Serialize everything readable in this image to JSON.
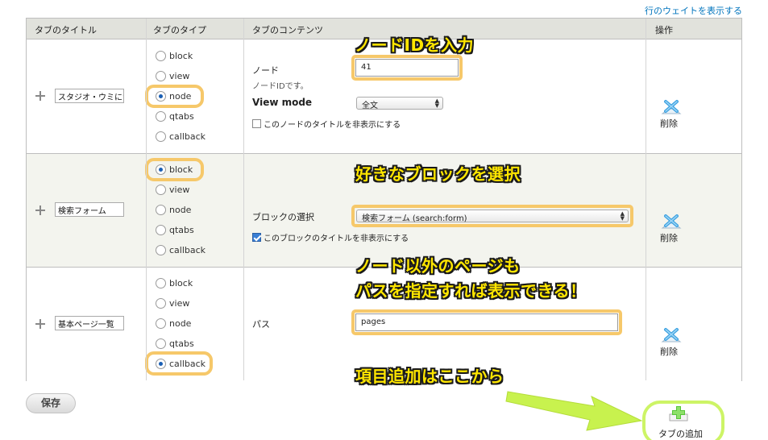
{
  "top_link": "行のウェイトを表示する",
  "table": {
    "headers": {
      "title": "タブのタイトル",
      "type": "タブのタイプ",
      "content": "タブのコンテンツ",
      "ops": "操作"
    }
  },
  "rows": [
    {
      "title_value": "スタジオ・ウミにつ",
      "radios": [
        "block",
        "view",
        "node",
        "qtabs",
        "callback"
      ],
      "selected": "node",
      "node_label": "ノード",
      "node_value": "41",
      "node_desc": "ノードIDです。",
      "view_mode_label": "View mode",
      "view_mode_value": "全文",
      "hide_title_label": "このノードのタイトルを非表示にする",
      "hide_title_checked": false,
      "delete_label": "削除"
    },
    {
      "title_value": "検索フォーム",
      "radios": [
        "block",
        "view",
        "node",
        "qtabs",
        "callback"
      ],
      "selected": "block",
      "block_label": "ブロックの選択",
      "block_value": "検索フォーム (search:form)",
      "hide_title_label": "このブロックのタイトルを非表示にする",
      "hide_title_checked": true,
      "delete_label": "削除"
    },
    {
      "title_value": "基本ページ一覧",
      "radios": [
        "block",
        "view",
        "node",
        "qtabs",
        "callback"
      ],
      "selected": "callback",
      "path_label": "パス",
      "path_value": "pages",
      "delete_label": "削除"
    }
  ],
  "callouts": {
    "node_id": "ノードIDを入力",
    "block": "好きなブロックを選択",
    "path_line1": "ノード以外のページも",
    "path_line2": "パスを指定すれば表示できる！",
    "add": "項目追加はここから"
  },
  "save_label": "保存",
  "add_tab_label": "タブの追加",
  "colors": {
    "highlight_orange": "#f6c86a",
    "highlight_green": "#cdf466",
    "callout_text": "#ffe600",
    "link": "#0074bd",
    "header_bg": "#e1e2dc"
  },
  "icons": {
    "drag": "drag-handle-icon",
    "delete": "delete-x-icon",
    "add": "add-plus-icon"
  }
}
